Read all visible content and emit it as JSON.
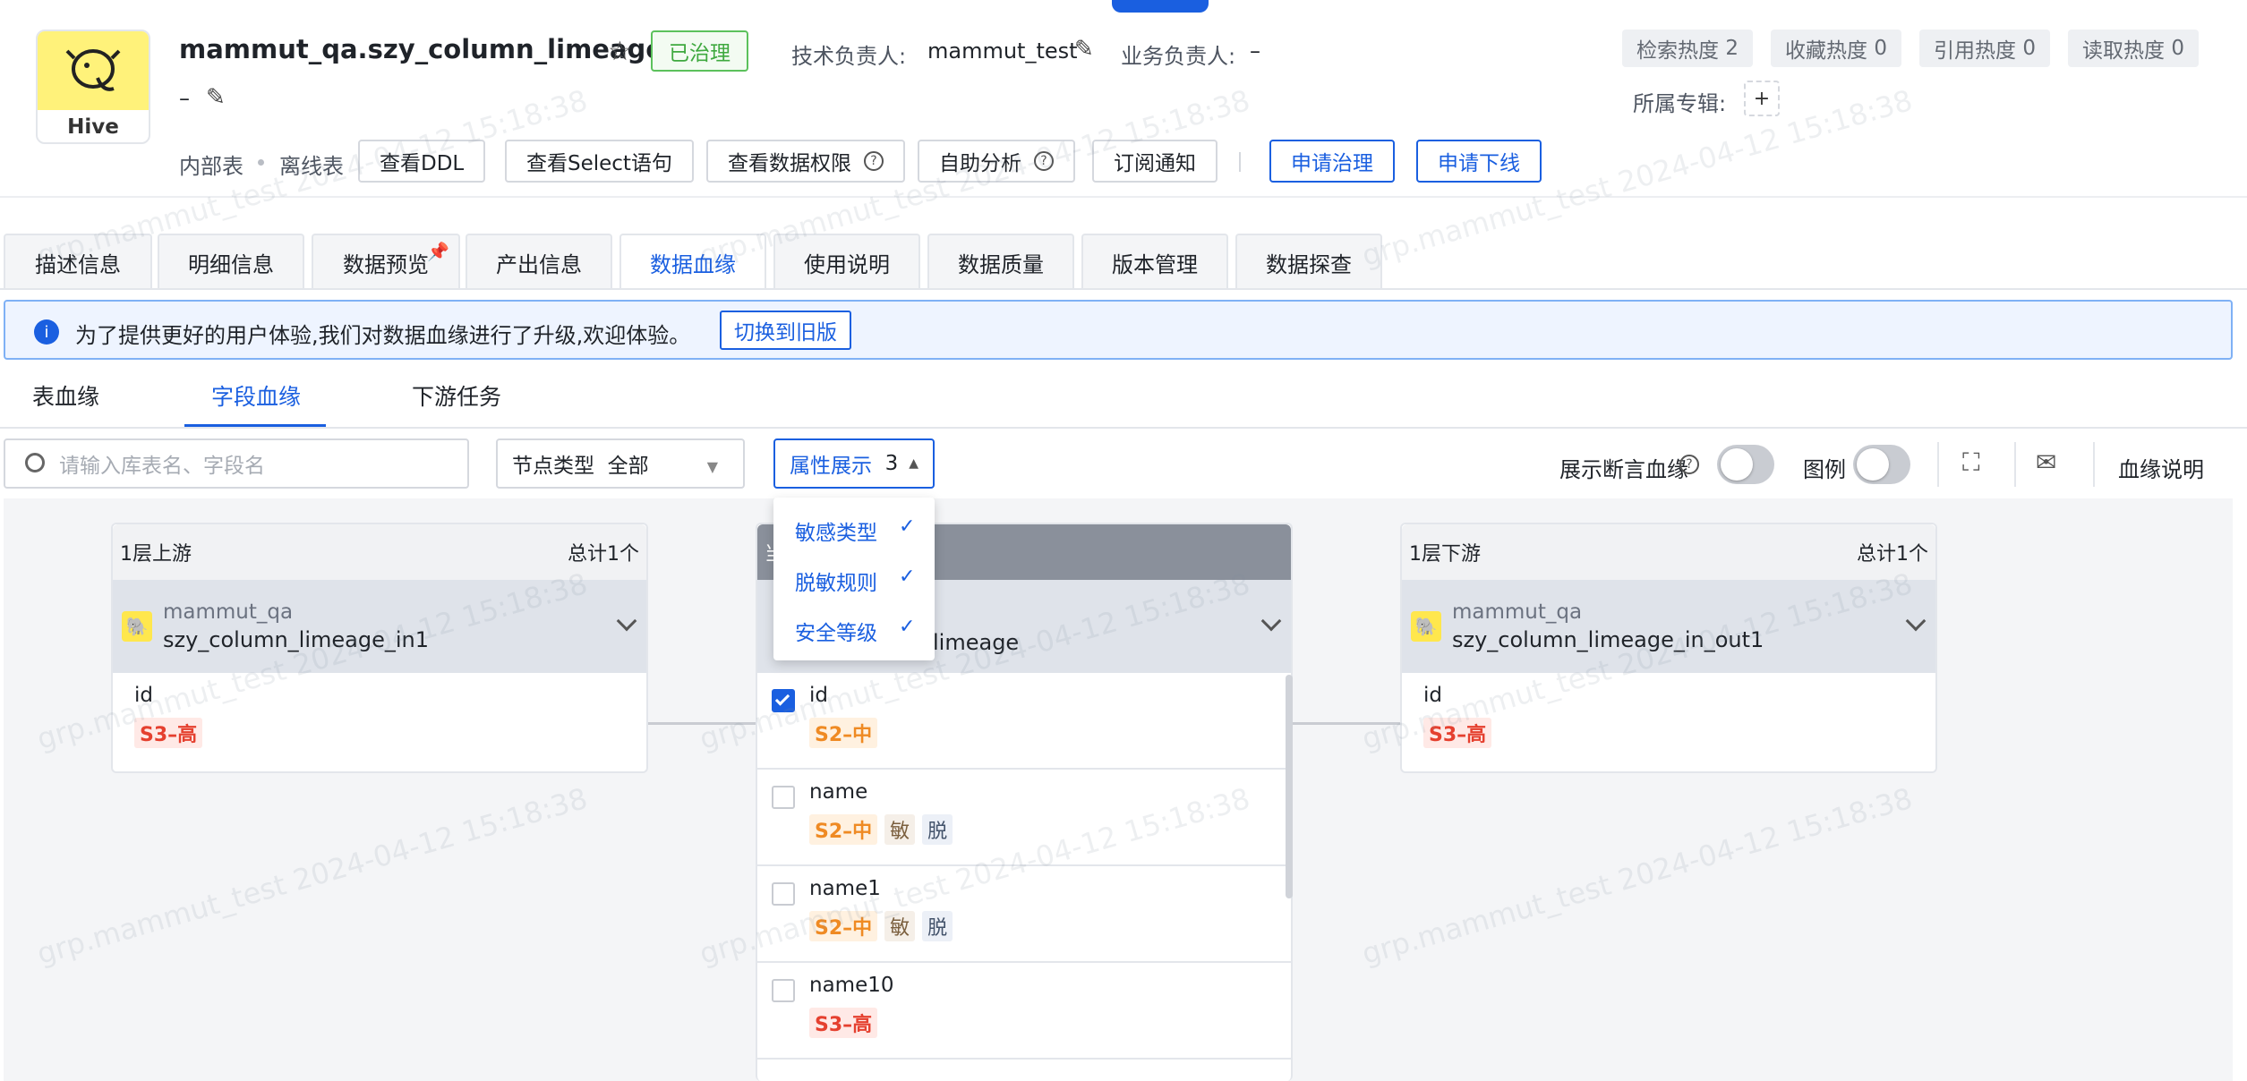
{
  "header": {
    "logo_label": "Hive",
    "title": "mammut_qa.szy_column_limeage",
    "status_badge": "已治理",
    "tech_owner_label": "技术负责人:",
    "tech_owner": "mammut_test",
    "biz_owner_label": "业务负责人:",
    "biz_owner": "–",
    "description": "–",
    "table_kind": "内部表",
    "table_mode": "离线表",
    "actions": [
      "查看DDL",
      "查看Select语句",
      "查看数据权限",
      "自助分析",
      "订阅通知"
    ],
    "primary_actions": [
      "申请治理",
      "申请下线"
    ],
    "stats": [
      {
        "label": "检索热度",
        "value": "2"
      },
      {
        "label": "收藏热度",
        "value": "0"
      },
      {
        "label": "引用热度",
        "value": "0"
      },
      {
        "label": "读取热度",
        "value": "0"
      }
    ],
    "album_label": "所属专辑:",
    "album_add": "+"
  },
  "tabs": [
    "描述信息",
    "明细信息",
    "数据预览",
    "产出信息",
    "数据血缘",
    "使用说明",
    "数据质量",
    "版本管理",
    "数据探查"
  ],
  "active_tab": "数据血缘",
  "notice": {
    "text": "为了提供更好的用户体验,我们对数据血缘进行了升级,欢迎体验。",
    "link": "切换到旧版"
  },
  "subtabs": [
    "表血缘",
    "字段血缘",
    "下游任务"
  ],
  "toolbar": {
    "search_placeholder": "请输入库表名、字段名",
    "node_type_label": "节点类型",
    "node_type_value": "全部",
    "attr_label": "属性展示",
    "attr_count": "3",
    "assert_label": "展示断言血缘",
    "legend_label": "图例",
    "lineage_help": "血缘说明"
  },
  "attr_options": [
    "敏感类型",
    "脱敏规则",
    "安全等级"
  ],
  "upstream": {
    "header": "1层上游",
    "total": "总计1个",
    "db": "mammut_qa",
    "table": "szy_column_limeage_in1",
    "fields": [
      {
        "name": "id",
        "level": "S3–高"
      }
    ]
  },
  "center": {
    "header_char": "当",
    "table_suffix": "limeage",
    "fields": [
      {
        "name": "id",
        "level": "S2–中",
        "sens": "",
        "mask": "",
        "checked": true
      },
      {
        "name": "name",
        "level": "S2–中",
        "sens": "敏",
        "mask": "脱",
        "checked": false
      },
      {
        "name": "name1",
        "level": "S2–中",
        "sens": "敏",
        "mask": "脱",
        "checked": false
      },
      {
        "name": "name10",
        "level": "S3–高",
        "sens": "",
        "mask": "",
        "checked": false
      }
    ]
  },
  "downstream": {
    "header": "1层下游",
    "total": "总计1个",
    "db": "mammut_qa",
    "table": "szy_column_limeage_in_out1",
    "fields": [
      {
        "name": "id",
        "level": "S3–高"
      }
    ]
  },
  "watermark": "grp.mammut_test 2024-04-12 15:18:38",
  "colors": {
    "accent": "#1a5fe0",
    "s3": "#e5402f",
    "s2": "#ef8a23"
  }
}
